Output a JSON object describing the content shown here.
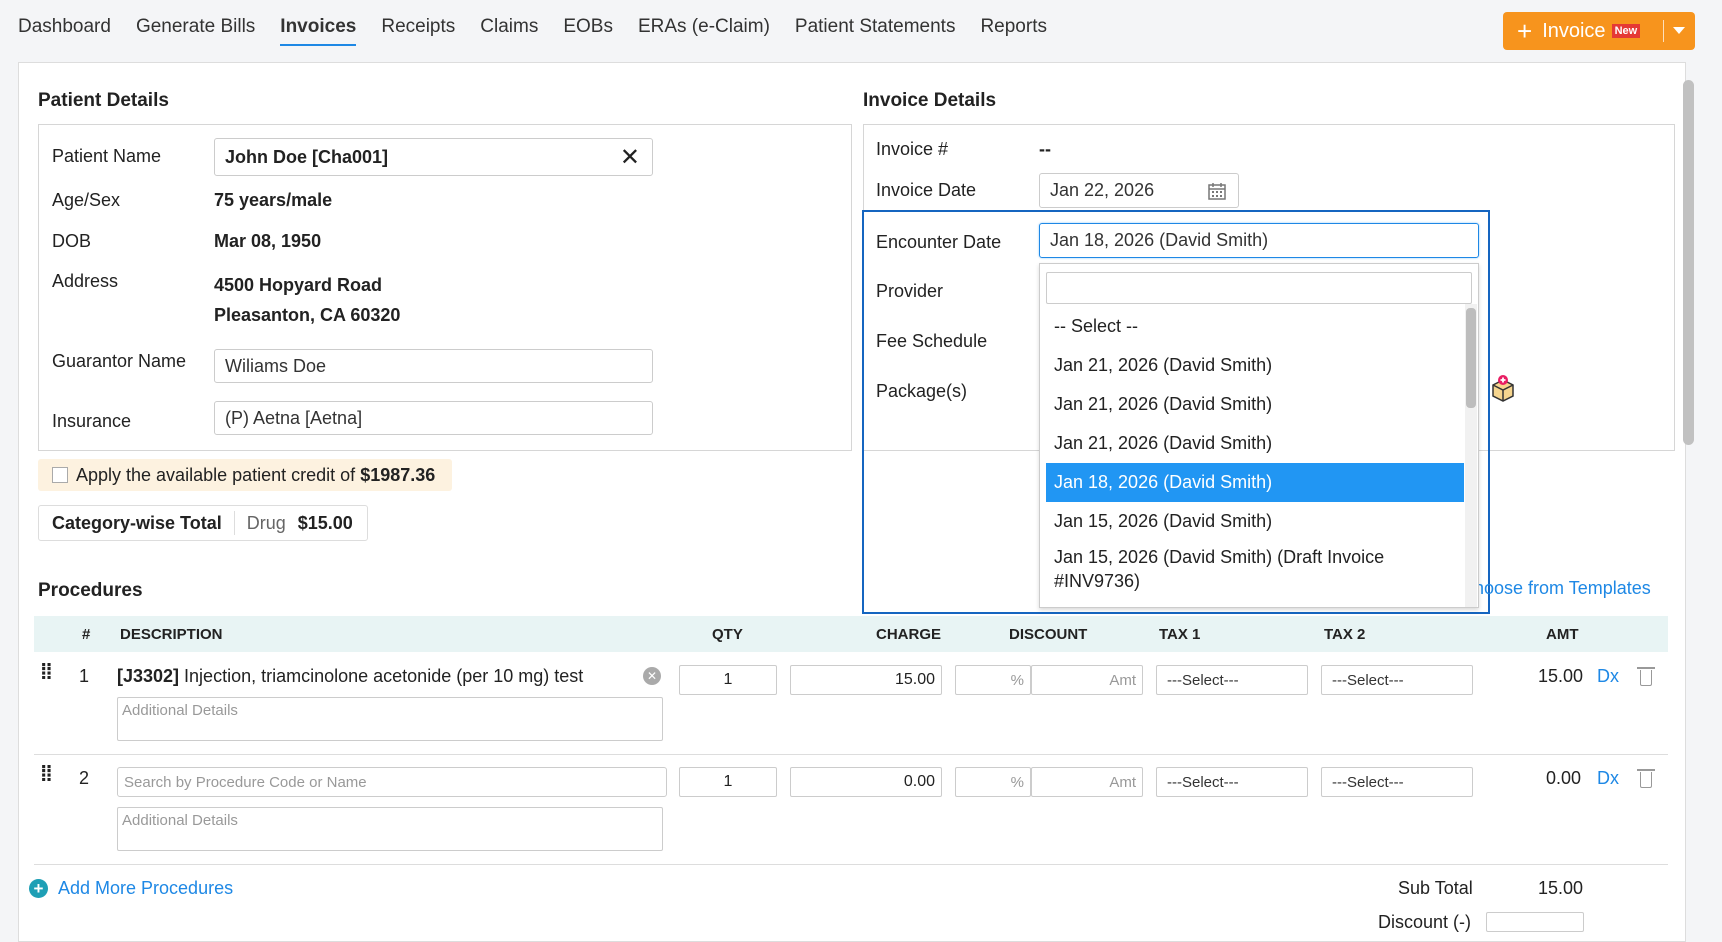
{
  "nav": {
    "tabs": [
      "Dashboard",
      "Generate Bills",
      "Invoices",
      "Receipts",
      "Claims",
      "EOBs",
      "ERAs (e-Claim)",
      "Patient Statements",
      "Reports"
    ],
    "active": "Invoices",
    "invoice_button": {
      "label": "Invoice",
      "badge": "New"
    }
  },
  "patient": {
    "title": "Patient Details",
    "name_label": "Patient Name",
    "name_value": "John Doe [Cha001]",
    "age_label": "Age/Sex",
    "age_value": "75 years/male",
    "dob_label": "DOB",
    "dob_value": "Mar 08, 1950",
    "address_label": "Address",
    "address_line1": "4500 Hopyard Road",
    "address_line2": "Pleasanton, CA 60320",
    "guarantor_label": "Guarantor Name",
    "guarantor_value": "Wiliams Doe",
    "insurance_label": "Insurance",
    "insurance_value": "(P) Aetna [Aetna]",
    "credit_text": "Apply the available patient credit of",
    "credit_amount": "$1987.36",
    "category_label": "Category-wise Total",
    "category_name": "Drug",
    "category_amount": "$15.00"
  },
  "invoice": {
    "title": "Invoice Details",
    "number_label": "Invoice #",
    "number_value": "--",
    "date_label": "Invoice Date",
    "date_value": "Jan 22, 2026",
    "encounter_label": "Encounter Date",
    "encounter_value": "Jan 18, 2026 (David Smith)",
    "provider_label": "Provider",
    "fee_label": "Fee Schedule",
    "package_label": "Package(s)",
    "choose_templates": "hoose from Templates"
  },
  "dropdown": {
    "options": [
      "-- Select --",
      "Jan 21, 2026 (David Smith)",
      "Jan 21, 2026 (David Smith)",
      "Jan 21, 2026 (David Smith)",
      "Jan 18, 2026 (David Smith)",
      "Jan 15, 2026 (David Smith)",
      "Jan 15, 2026 (David Smith) (Draft Invoice",
      "#INV9736)"
    ],
    "selected_index": 4
  },
  "procedures": {
    "title": "Procedures",
    "headers": {
      "num": "#",
      "desc": "DESCRIPTION",
      "qty": "QTY",
      "charge": "CHARGE",
      "discount": "DISCOUNT",
      "tax1": "TAX 1",
      "tax2": "TAX 2",
      "amt": "AMT"
    },
    "row1": {
      "num": "1",
      "code": "[J3302]",
      "desc": " Injection, triamcinolone acetonide (per 10 mg) test",
      "details_placeholder": "Additional Details",
      "qty": "1",
      "charge": "15.00",
      "pct": "%",
      "amt_placeholder": "Amt",
      "tax1": "---Select---",
      "tax2": "---Select---",
      "amt": "15.00",
      "dx": "Dx"
    },
    "row2": {
      "num": "2",
      "search_placeholder": "Search by Procedure Code or Name",
      "details_placeholder": "Additional Details",
      "qty": "1",
      "charge": "0.00",
      "pct": "%",
      "amt_placeholder": "Amt",
      "tax1": "---Select---",
      "tax2": "---Select---",
      "amt": "0.00",
      "dx": "Dx"
    },
    "add_more": "Add More Procedures",
    "subtotal_label": "Sub Total",
    "subtotal_value": "15.00",
    "discount_label": "Discount (-)"
  }
}
